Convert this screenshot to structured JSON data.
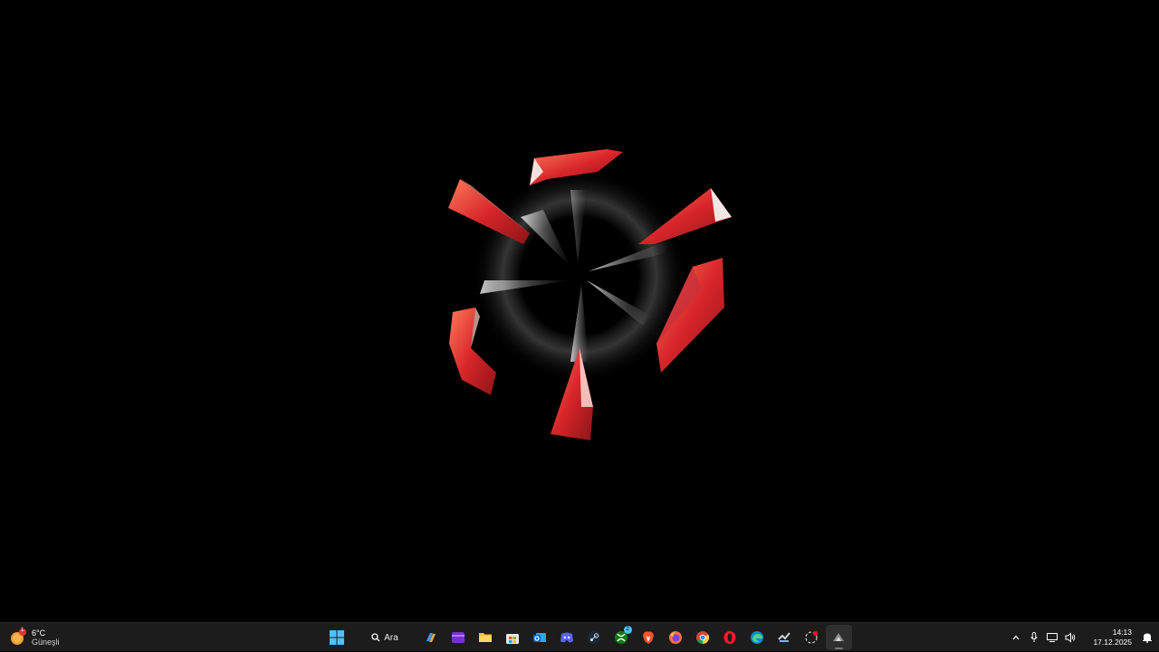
{
  "taskbar": {
    "weather": {
      "temperature": "6°C",
      "condition": "Güneşli",
      "badge_count": "1",
      "icon": "sun-weather-icon"
    },
    "search_label": "Ara",
    "pinned_apps": [
      {
        "name": "start-button",
        "icon": "windows-logo-icon"
      },
      {
        "name": "copilot",
        "icon": "copilot-icon"
      },
      {
        "name": "clipchamp",
        "icon": "clipchamp-icon"
      },
      {
        "name": "file-explorer",
        "icon": "folder-icon"
      },
      {
        "name": "microsoft-store",
        "icon": "store-icon"
      },
      {
        "name": "outlook",
        "icon": "outlook-icon"
      },
      {
        "name": "discord",
        "icon": "discord-icon"
      },
      {
        "name": "steam",
        "icon": "steam-icon"
      },
      {
        "name": "xbox",
        "icon": "xbox-icon",
        "badge": "2"
      },
      {
        "name": "brave",
        "icon": "brave-icon"
      },
      {
        "name": "firefox",
        "icon": "firefox-icon"
      },
      {
        "name": "chrome",
        "icon": "chrome-icon"
      },
      {
        "name": "opera",
        "icon": "opera-icon"
      },
      {
        "name": "edge",
        "icon": "edge-icon"
      },
      {
        "name": "steam-2",
        "icon": "steam-icon"
      },
      {
        "name": "app-loading",
        "icon": "loading-app-icon"
      },
      {
        "name": "active-app",
        "icon": "active-app-icon"
      }
    ],
    "tray": {
      "time": "14:13",
      "date": "17.12.2025"
    }
  },
  "colors": {
    "taskbar_bg": "#1c1c1c",
    "desktop_bg": "#000000",
    "accent_red": "#e0342c"
  }
}
